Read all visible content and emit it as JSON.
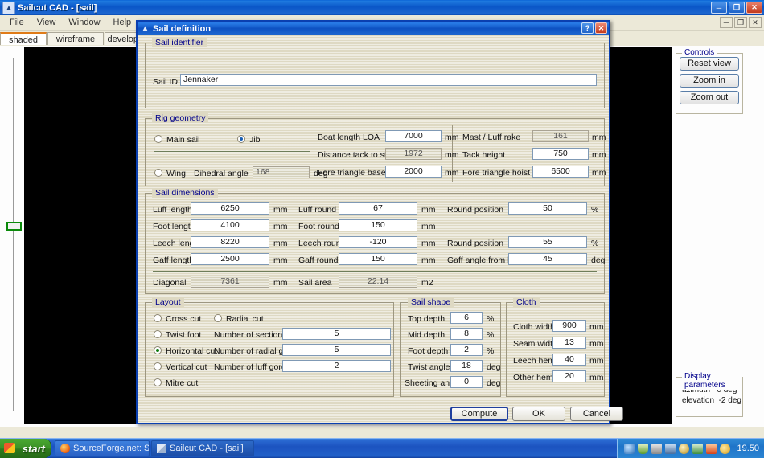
{
  "app": {
    "title": "Sailcut CAD - [sail]",
    "icon": "sail-icon",
    "menu": [
      "File",
      "View",
      "Window",
      "Help"
    ],
    "window_buttons": [
      "minimize",
      "restore",
      "close"
    ],
    "mdi_buttons": [
      "minimize",
      "restore",
      "close"
    ],
    "tabs": [
      {
        "label": "shaded view",
        "active": true
      },
      {
        "label": "wireframe view",
        "active": false
      },
      {
        "label": "development",
        "active": false
      }
    ]
  },
  "controls_panel": {
    "legend": "Controls",
    "buttons": [
      "Reset view",
      "Zoom in",
      "Zoom out"
    ]
  },
  "display_panel": {
    "legend": "Display parameters",
    "rows": [
      {
        "label": "azimuth",
        "value": "0 deg"
      },
      {
        "label": "elevation",
        "value": "-2 deg"
      }
    ]
  },
  "dialog": {
    "title": "Sail definition",
    "help_label": "?",
    "close_label": "✕",
    "sail_identifier": {
      "legend": "Sail identifier",
      "label": "Sail ID",
      "value": "Jennaker"
    },
    "rig_geometry": {
      "legend": "Rig geometry",
      "radios": [
        {
          "label": "Main sail",
          "selected": false
        },
        {
          "label": "Jib",
          "selected": true
        },
        {
          "label": "Wing",
          "selected": false
        }
      ],
      "dihedral_label": "Dihedral angle",
      "dihedral_value": "168",
      "dihedral_unit": "deg",
      "fields": [
        {
          "label": "Boat length LOA",
          "value": "7000",
          "unit": "mm",
          "readonly": false
        },
        {
          "label": "Distance tack to stem",
          "value": "1972",
          "unit": "mm",
          "readonly": true
        },
        {
          "label": "Fore triangle base  J",
          "value": "2000",
          "unit": "mm",
          "readonly": false
        },
        {
          "label": "Mast / Luff rake",
          "value": "161",
          "unit": "mm",
          "readonly": true
        },
        {
          "label": "Tack height",
          "value": "750",
          "unit": "mm",
          "readonly": false
        },
        {
          "label": "Fore triangle hoist  I",
          "value": "6500",
          "unit": "mm",
          "readonly": false
        }
      ]
    },
    "sail_dimensions": {
      "legend": "Sail dimensions",
      "col1": [
        {
          "label": "Luff length",
          "value": "6250",
          "unit": "mm"
        },
        {
          "label": "Foot length",
          "value": "4100",
          "unit": "mm"
        },
        {
          "label": "Leech length",
          "value": "8220",
          "unit": "mm"
        },
        {
          "label": "Gaff length",
          "value": "2500",
          "unit": "mm"
        }
      ],
      "col2": [
        {
          "label": "Luff round",
          "value": "67",
          "unit": "mm"
        },
        {
          "label": "Foot round",
          "value": "150",
          "unit": "mm"
        },
        {
          "label": "Leech round",
          "value": "-120",
          "unit": "mm"
        },
        {
          "label": "Gaff round",
          "value": "150",
          "unit": "mm"
        }
      ],
      "col3": [
        {
          "label": "Round position",
          "value": "50",
          "unit": "%"
        },
        {
          "label": "Round position",
          "value": "55",
          "unit": "%"
        },
        {
          "label": "Gaff angle from luff",
          "value": "45",
          "unit": "deg"
        }
      ],
      "summary": [
        {
          "label": "Diagonal",
          "value": "7361",
          "unit": "mm"
        },
        {
          "label": "Sail area",
          "value": "22.14",
          "unit": "m2"
        }
      ]
    },
    "layout": {
      "legend": "Layout",
      "cut_options": [
        {
          "label": "Cross cut",
          "selected": false
        },
        {
          "label": "Twist foot",
          "selected": false
        },
        {
          "label": "Horizontal cut",
          "selected": true
        },
        {
          "label": "Vertical cut",
          "selected": false
        },
        {
          "label": "Mitre cut",
          "selected": false
        }
      ],
      "radial": {
        "label": "Radial cut",
        "selected": false
      },
      "fields": [
        {
          "label": "Number of sections",
          "value": "5"
        },
        {
          "label": "Number of radial gores",
          "value": "5"
        },
        {
          "label": "Number of luff gores",
          "value": "2"
        }
      ]
    },
    "sail_shape": {
      "legend": "Sail shape",
      "fields": [
        {
          "label": "Top depth",
          "value": "6",
          "unit": "%"
        },
        {
          "label": "Mid depth",
          "value": "8",
          "unit": "%"
        },
        {
          "label": "Foot depth",
          "value": "2",
          "unit": "%"
        },
        {
          "label": "Twist angle",
          "value": "18",
          "unit": "deg"
        },
        {
          "label": "Sheeting angle",
          "value": "0",
          "unit": "deg"
        }
      ]
    },
    "cloth": {
      "legend": "Cloth",
      "fields": [
        {
          "label": "Cloth width",
          "value": "900",
          "unit": "mm"
        },
        {
          "label": "Seam width",
          "value": "13",
          "unit": "mm"
        },
        {
          "label": "Leech hem",
          "value": "40",
          "unit": "mm"
        },
        {
          "label": "Other hems",
          "value": "20",
          "unit": "mm"
        }
      ]
    },
    "buttons": [
      {
        "label": "Compute",
        "default": true
      },
      {
        "label": "OK",
        "default": false
      },
      {
        "label": "Cancel",
        "default": false
      }
    ]
  },
  "taskbar": {
    "start_label": "start",
    "items": [
      {
        "label": "SourceForge.net: Sail...",
        "icon": "firefox-icon",
        "active": false
      },
      {
        "label": "Sailcut CAD - [sail]",
        "icon": "sailcut-icon",
        "active": true
      }
    ],
    "tray_icons": [
      "network-icon",
      "shield-icon",
      "save-icon",
      "monitor-icon",
      "clock-icon",
      "printer-icon",
      "power-icon",
      "volume-icon"
    ],
    "time": "19.50"
  }
}
